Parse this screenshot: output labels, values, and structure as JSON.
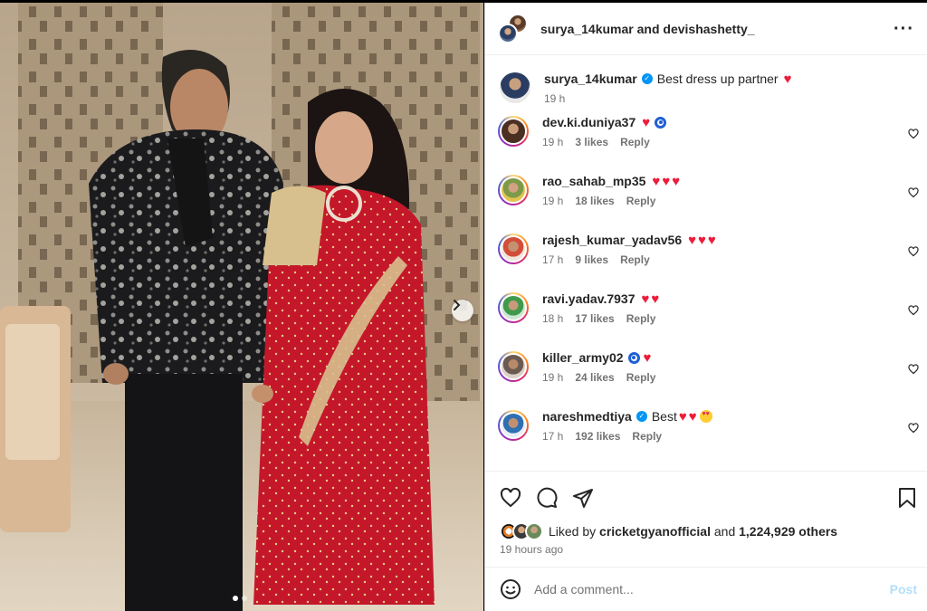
{
  "post": {
    "header_user1": "surya_14kumar",
    "header_and": "and",
    "header_user2": "devishashetty_",
    "slide_count": 2,
    "active_slide": 1
  },
  "caption": {
    "username": "surya_14kumar",
    "text": "Best dress up partner",
    "time": "19 h"
  },
  "comments": [
    {
      "username": "dev.ki.duniya37",
      "time": "19 h",
      "likes": "3 likes",
      "reply": "Reply"
    },
    {
      "username": "rao_sahab_mp35",
      "time": "19 h",
      "likes": "18 likes",
      "reply": "Reply"
    },
    {
      "username": "rajesh_kumar_yadav56",
      "time": "17 h",
      "likes": "9 likes",
      "reply": "Reply"
    },
    {
      "username": "ravi.yadav.7937",
      "time": "18 h",
      "likes": "17 likes",
      "reply": "Reply"
    },
    {
      "username": "killer_army02",
      "time": "19 h",
      "likes": "24 likes",
      "reply": "Reply"
    },
    {
      "username": "nareshmedtiya",
      "text": "Best",
      "time": "17 h",
      "likes": "192 likes",
      "reply": "Reply"
    }
  ],
  "likes": {
    "prefix": "Liked by",
    "user": "cricketgyanofficial",
    "and": "and",
    "count": "1,224,929 others"
  },
  "posted_time": "19 hours ago",
  "comment_input": {
    "placeholder": "Add a comment...",
    "post_label": "Post"
  },
  "colors": {
    "accent": "#0095f6",
    "heart": "#ed1c3a",
    "post_disabled": "#b2dffc",
    "saree": "#c4182a"
  },
  "icons": [
    "more-icon",
    "verified-icon",
    "heart-icon",
    "comment-icon",
    "share-icon",
    "save-icon",
    "emoji-icon",
    "chevron-right-icon"
  ]
}
